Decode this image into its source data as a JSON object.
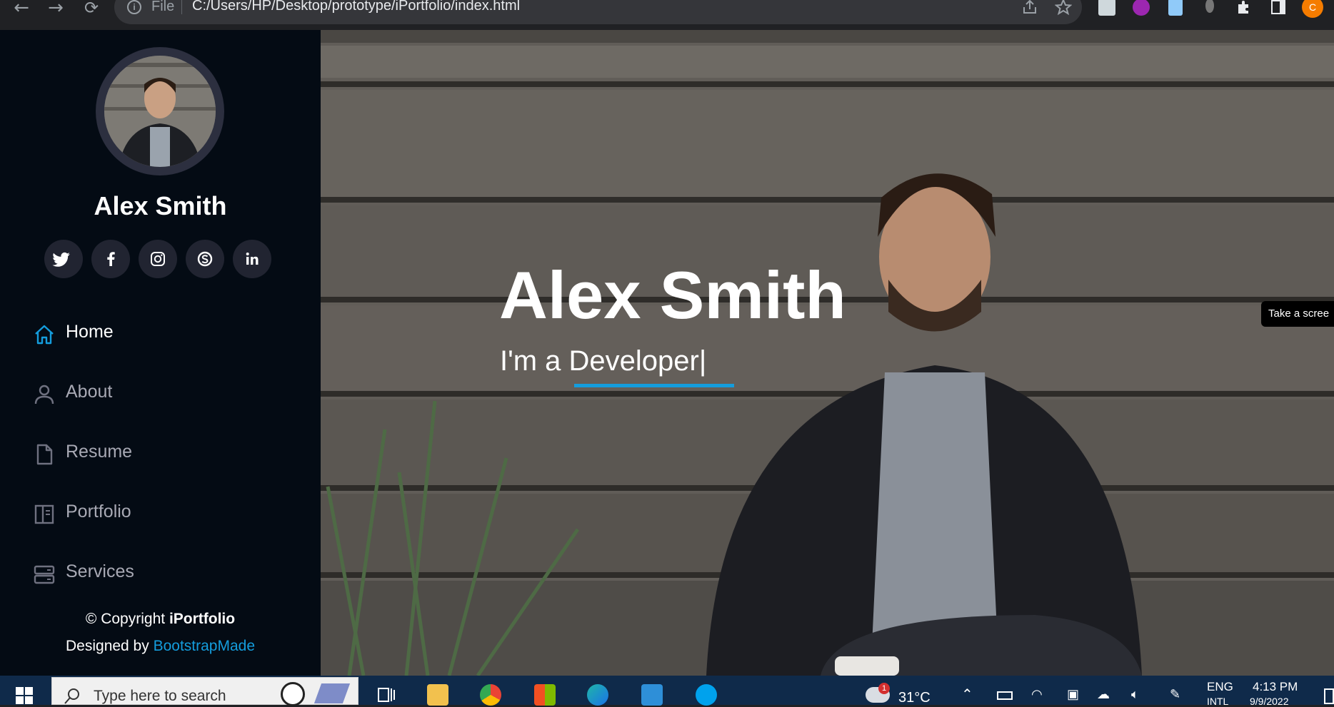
{
  "browser": {
    "info_label": "File",
    "url": "C:/Users/HP/Desktop/prototype/iPortfolio/index.html",
    "profile_initial": "C"
  },
  "sidebar": {
    "name": "Alex Smith",
    "social": [
      {
        "icon": "twitter-icon",
        "glyph": "t"
      },
      {
        "icon": "facebook-icon",
        "glyph": "f"
      },
      {
        "icon": "instagram-icon",
        "glyph": "◎"
      },
      {
        "icon": "skype-icon",
        "glyph": "S"
      },
      {
        "icon": "linkedin-icon",
        "glyph": "in"
      }
    ],
    "menu": [
      {
        "label": "Home",
        "icon": "home-icon",
        "active": true
      },
      {
        "label": "About",
        "icon": "person-icon",
        "active": false
      },
      {
        "label": "Resume",
        "icon": "file-icon",
        "active": false
      },
      {
        "label": "Portfolio",
        "icon": "book-icon",
        "active": false
      },
      {
        "label": "Services",
        "icon": "server-icon",
        "active": false
      }
    ],
    "copyright_prefix": "© Copyright ",
    "copyright_brand": "iPortfolio",
    "designed_prefix": "Designed by ",
    "designed_link": "BootstrapMade"
  },
  "hero": {
    "title": "Alex Smith",
    "subtitle": "I'm a Developer|",
    "tooltip": "Take a scree"
  },
  "taskbar": {
    "search_placeholder": "Type here to search",
    "weather_badge": "1",
    "temperature": "31°C",
    "language": "ENG",
    "language_sub": "INTL",
    "time": "4:13 PM",
    "date": "9/9/2022"
  },
  "colors": {
    "accent": "#149ddd",
    "sidebar_bg": "#040b14"
  }
}
